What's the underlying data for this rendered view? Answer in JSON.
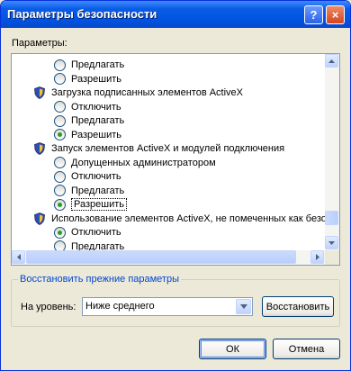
{
  "window": {
    "title": "Параметры безопасности",
    "help_glyph": "?",
    "close_glyph": "×"
  },
  "settings": {
    "label": "Параметры:",
    "rows": [
      {
        "kind": "radio",
        "text": "Предлагать",
        "selected": false
      },
      {
        "kind": "radio",
        "text": "Разрешить",
        "selected": false
      },
      {
        "kind": "category",
        "text": "Загрузка подписанных элементов ActiveX"
      },
      {
        "kind": "radio",
        "text": "Отключить",
        "selected": false
      },
      {
        "kind": "radio",
        "text": "Предлагать",
        "selected": false
      },
      {
        "kind": "radio",
        "text": "Разрешить",
        "selected": true
      },
      {
        "kind": "category",
        "text": "Запуск элементов ActiveX и модулей подключения"
      },
      {
        "kind": "radio",
        "text": "Допущенных администратором",
        "selected": false
      },
      {
        "kind": "radio",
        "text": "Отключить",
        "selected": false
      },
      {
        "kind": "radio",
        "text": "Предлагать",
        "selected": false
      },
      {
        "kind": "radio",
        "text": "Разрешить",
        "selected": true,
        "focused": true
      },
      {
        "kind": "category",
        "text": "Использование элементов ActiveX, не помеченных как безо"
      },
      {
        "kind": "radio",
        "text": "Отключить",
        "selected": true
      },
      {
        "kind": "radio",
        "text": "Предлагать",
        "selected": false
      }
    ]
  },
  "reset": {
    "group_title": "Восстановить прежние параметры",
    "level_label": "На уровень:",
    "level_value": "Ниже среднего",
    "restore_button": "Восстановить"
  },
  "buttons": {
    "ok": "ОК",
    "cancel": "Отмена"
  },
  "colors": {
    "accent": "#0054e3",
    "radio_selected": "#21a121",
    "group_title": "#0046d5"
  }
}
